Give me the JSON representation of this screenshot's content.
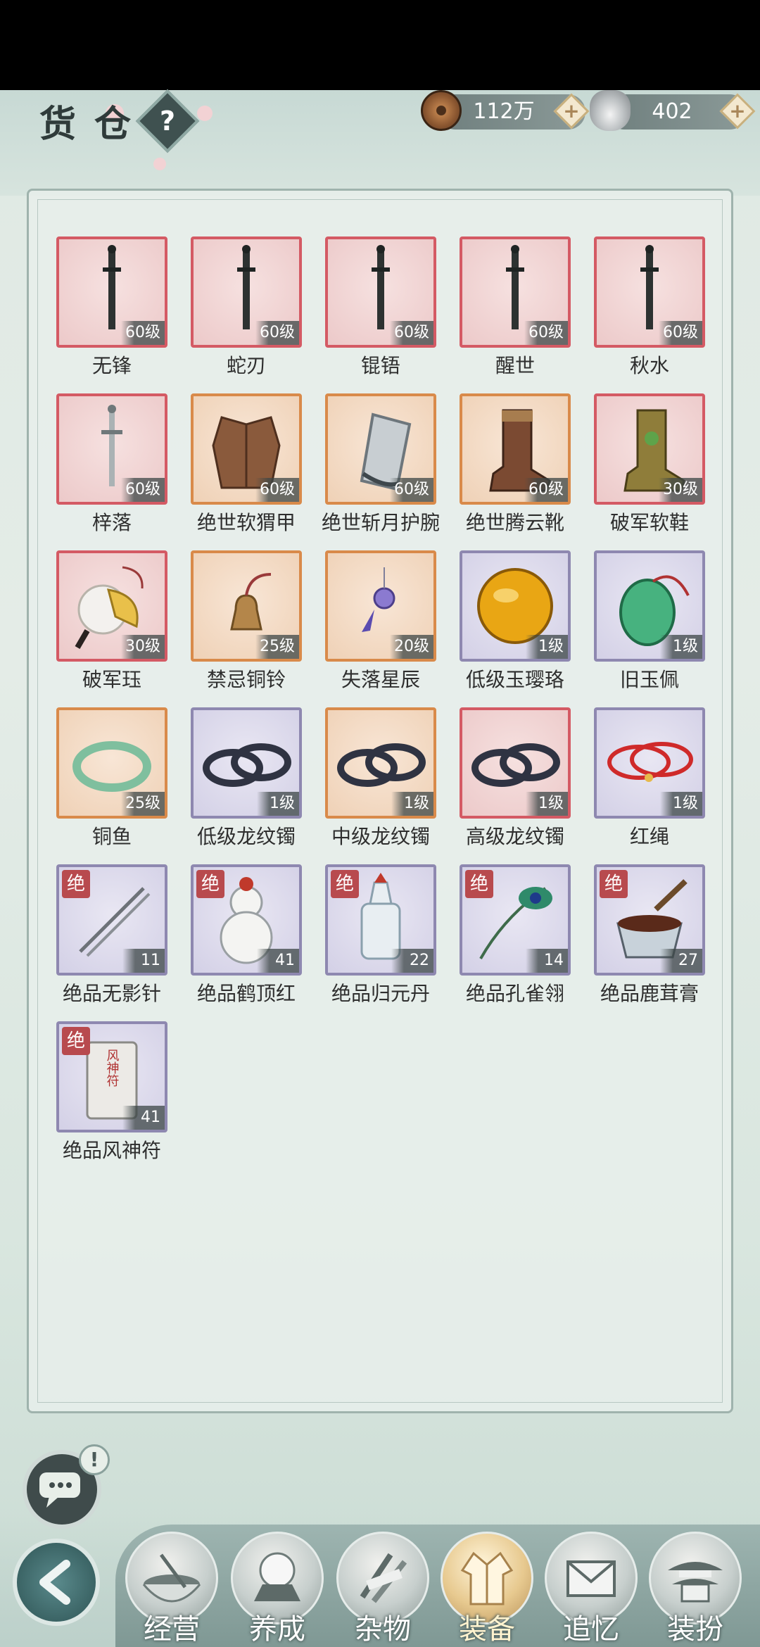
{
  "header": {
    "title": "货仓",
    "help_symbol": "?",
    "copper": {
      "value": "112万",
      "plus": "+"
    },
    "silver": {
      "value": "402",
      "plus": "+"
    }
  },
  "items": [
    {
      "name": "无锋",
      "level": "60级",
      "frame": "red",
      "art": "sword"
    },
    {
      "name": "蛇刃",
      "level": "60级",
      "frame": "red",
      "art": "sword"
    },
    {
      "name": "锟铻",
      "level": "60级",
      "frame": "red",
      "art": "sword"
    },
    {
      "name": "醒世",
      "level": "60级",
      "frame": "red",
      "art": "sword"
    },
    {
      "name": "秋水",
      "level": "60级",
      "frame": "red",
      "art": "sword"
    },
    {
      "name": "梓落",
      "level": "60级",
      "frame": "red",
      "art": "silver-sword"
    },
    {
      "name": "绝世软猬甲",
      "level": "60级",
      "frame": "orange",
      "art": "armor"
    },
    {
      "name": "绝世斩月护腕",
      "level": "60级",
      "frame": "orange",
      "art": "bracer"
    },
    {
      "name": "绝世腾云靴",
      "level": "60级",
      "frame": "orange",
      "art": "boot"
    },
    {
      "name": "破军软鞋",
      "level": "30级",
      "frame": "red",
      "art": "boot-gold"
    },
    {
      "name": "破军珏",
      "level": "30级",
      "frame": "red",
      "art": "pendant"
    },
    {
      "name": "禁忌铜铃",
      "level": "25级",
      "frame": "orange",
      "art": "bell"
    },
    {
      "name": "失落星辰",
      "level": "20级",
      "frame": "orange",
      "art": "star-charm"
    },
    {
      "name": "低级玉璎珞",
      "level": "1级",
      "frame": "purple",
      "art": "amber"
    },
    {
      "name": "旧玉佩",
      "level": "1级",
      "frame": "purple",
      "art": "jade"
    },
    {
      "name": "铜鱼",
      "level": "25级",
      "frame": "orange",
      "art": "bangle-green"
    },
    {
      "name": "低级龙纹镯",
      "level": "1级",
      "frame": "purple",
      "art": "bangles"
    },
    {
      "name": "中级龙纹镯",
      "level": "1级",
      "frame": "orange",
      "art": "bangles"
    },
    {
      "name": "高级龙纹镯",
      "level": "1级",
      "frame": "red",
      "art": "bangles"
    },
    {
      "name": "红绳",
      "level": "1级",
      "frame": "purple",
      "art": "red-cord"
    },
    {
      "name": "绝品无影针",
      "count": "11",
      "badge": "绝",
      "frame": "purple",
      "art": "needles"
    },
    {
      "name": "绝品鹤顶红",
      "count": "41",
      "badge": "绝",
      "frame": "purple",
      "art": "gourd"
    },
    {
      "name": "绝品归元丹",
      "count": "22",
      "badge": "绝",
      "frame": "purple",
      "art": "bottle"
    },
    {
      "name": "绝品孔雀翎",
      "count": "14",
      "badge": "绝",
      "frame": "purple",
      "art": "feather"
    },
    {
      "name": "绝品鹿茸膏",
      "count": "27",
      "badge": "绝",
      "frame": "purple",
      "art": "mortar"
    },
    {
      "name": "绝品风神符",
      "count": "41",
      "badge": "绝",
      "frame": "purple",
      "art": "talisman",
      "talisman_text": "风神符"
    }
  ],
  "chat": {
    "alert": "!"
  },
  "tabs": [
    {
      "label": "经营",
      "active": false,
      "icon": "bowl-icon"
    },
    {
      "label": "养成",
      "active": false,
      "icon": "orb-icon"
    },
    {
      "label": "杂物",
      "active": false,
      "icon": "sticks-icon"
    },
    {
      "label": "装备",
      "active": true,
      "icon": "robe-icon"
    },
    {
      "label": "追忆",
      "active": false,
      "icon": "letter-icon"
    },
    {
      "label": "装扮",
      "active": false,
      "icon": "pavilion-icon"
    }
  ],
  "colors": {
    "frame_red": "#d45a64",
    "frame_orange": "#d98a4a",
    "frame_purple": "#8e88b0",
    "badge": "#b84a4e"
  }
}
